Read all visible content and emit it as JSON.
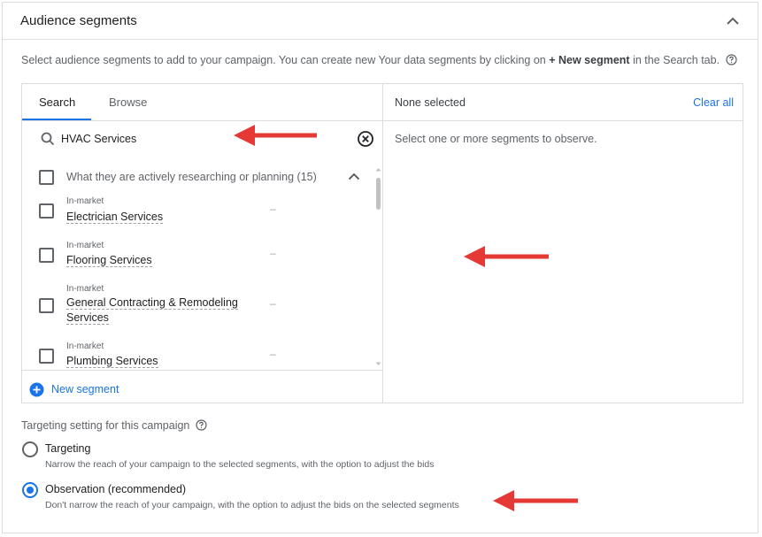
{
  "header": {
    "title": "Audience segments"
  },
  "description": {
    "before": "Select audience segments to add to your campaign. You can create new Your data segments by clicking on",
    "bold": "+ New segment",
    "after": "in the Search tab."
  },
  "tabs": [
    {
      "label": "Search",
      "active": true
    },
    {
      "label": "Browse",
      "active": false
    }
  ],
  "search": {
    "value": "HVAC Services"
  },
  "group": {
    "label": "What they are actively researching or planning (15)"
  },
  "items": [
    {
      "category": "In-market",
      "name": "Electrician Services",
      "value": "–"
    },
    {
      "category": "In-market",
      "name": "Flooring Services",
      "value": "–"
    },
    {
      "category": "In-market",
      "name": "General Contracting & Remodeling Services",
      "value": "–"
    },
    {
      "category": "In-market",
      "name": "Plumbing Services",
      "value": "–"
    }
  ],
  "new_segment": {
    "label": "New segment"
  },
  "selection": {
    "status": "None selected",
    "clear_all": "Clear all",
    "hint": "Select one or more segments to observe."
  },
  "targeting": {
    "title": "Targeting setting for this campaign",
    "options": [
      {
        "label": "Targeting",
        "description": "Narrow the reach of your campaign to the selected segments, with the option to adjust the bids",
        "checked": false
      },
      {
        "label": "Observation (recommended)",
        "description": "Don't narrow the reach of your campaign, with the option to adjust the bids on the selected segments",
        "checked": true
      }
    ]
  },
  "colors": {
    "accent": "#1a73e8",
    "annotation_arrow": "#e53935"
  },
  "icons": [
    "chevron-up-icon",
    "help-icon",
    "search-icon",
    "clear-circle-icon",
    "plus-circle-icon",
    "arrow-left-annotation"
  ]
}
